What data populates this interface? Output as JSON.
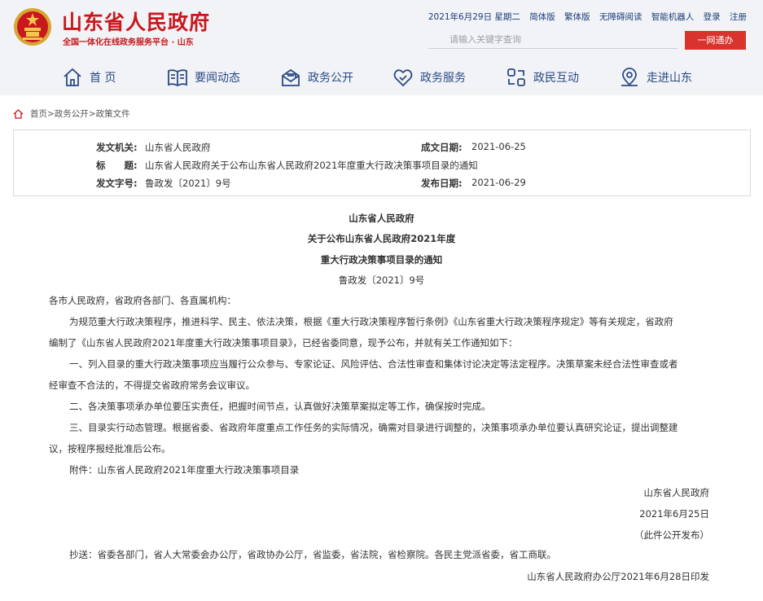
{
  "header": {
    "site_title": "山东省人民政府",
    "site_subtitle": "全国一体化在线政务服务平台 · 山东",
    "date": "2021年6月29日 星期二",
    "links": [
      "简体版",
      "繁体版",
      "无障碍阅读",
      "智能机器人",
      "登录",
      "注册"
    ],
    "search_placeholder": "请输入关键字查询",
    "yiwang_button": "一网通办",
    "brand_color": "#c8181e"
  },
  "nav": {
    "items": [
      {
        "label": "首 页",
        "icon": "home-icon"
      },
      {
        "label": "要闻动态",
        "icon": "news-icon"
      },
      {
        "label": "政务公开",
        "icon": "mail-open-icon"
      },
      {
        "label": "政务服务",
        "icon": "heart-icon"
      },
      {
        "label": "政民互动",
        "icon": "interaction-icon"
      },
      {
        "label": "走进山东",
        "icon": "location-icon"
      }
    ]
  },
  "breadcrumb": {
    "items": [
      "首页",
      "政务公开",
      "政策文件"
    ],
    "sep": ">"
  },
  "meta": {
    "issuer_label": "发文机关:",
    "issuer": "山东省人民政府",
    "made_date_label": "成文日期:",
    "made_date": "2021-06-25",
    "title_label": "标　　题:",
    "title": "山东省人民政府关于公布山东省人民政府2021年度重大行政决策事项目录的通知",
    "doc_no_label": "发文字号:",
    "doc_no": "鲁政发〔2021〕9号",
    "publish_date_label": "发布日期:",
    "publish_date": "2021-06-29"
  },
  "article": {
    "heading1": "山东省人民政府",
    "heading2": "关于公布山东省人民政府2021年度",
    "heading3": "重大行政决策事项目录的通知",
    "doc_no": "鲁政发〔2021〕9号",
    "salutation": "各市人民政府，省政府各部门、各直属机构：",
    "p1_line1": "为规范重大行政决策程序，推进科学、民主、依法决策，根据《重大行政决策程序暂行条例》《山东省重大行政决策程序规定》等有关规定，省政府",
    "p1_line2": "编制了《山东省人民政府2021年度重大行政决策事项目录》，已经省委同意，现予公布，并就有关工作通知如下：",
    "p2_line1": "一、列入目录的重大行政决策事项应当履行公众参与、专家论证、风险评估、合法性审查和集体讨论决定等法定程序。决策草案未经合法性审查或者",
    "p2_line2": "经审查不合法的，不得提交省政府常务会议审议。",
    "p3": "二、各决策事项承办单位要压实责任，把握时间节点，认真做好决策草案拟定等工作，确保按时完成。",
    "p4_line1": "三、目录实行动态管理。根据省委、省政府年度重点工作任务的实际情况，确需对目录进行调整的，决策事项承办单位要认真研究论证，提出调整建",
    "p4_line2": "议，按程序报经批准后公布。",
    "attachment": "附件：山东省人民政府2021年度重大行政决策事项目录",
    "signature": "山东省人民政府",
    "sign_date": "2021年6月25日",
    "public_note": "（此件公开发布）",
    "cc": "抄送：省委各部门，省人大常委会办公厅，省政协办公厅，省监委，省法院，省检察院。各民主党派省委，省工商联。",
    "print_note": "山东省人民政府办公厅2021年6月28日印发"
  }
}
